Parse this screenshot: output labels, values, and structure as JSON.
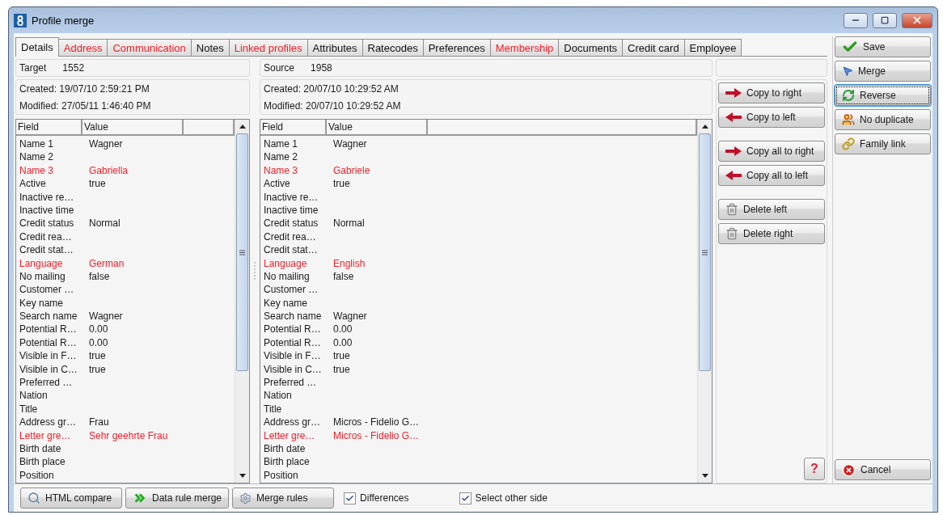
{
  "window": {
    "title": "Profile merge"
  },
  "tabs": [
    {
      "label": "Details",
      "selected": true,
      "differs": false
    },
    {
      "label": "Address",
      "selected": false,
      "differs": true
    },
    {
      "label": "Communication",
      "selected": false,
      "differs": true
    },
    {
      "label": "Notes",
      "selected": false,
      "differs": false
    },
    {
      "label": "Linked profiles",
      "selected": false,
      "differs": true
    },
    {
      "label": "Attributes",
      "selected": false,
      "differs": false
    },
    {
      "label": "Ratecodes",
      "selected": false,
      "differs": false
    },
    {
      "label": "Preferences",
      "selected": false,
      "differs": false
    },
    {
      "label": "Membership",
      "selected": false,
      "differs": true
    },
    {
      "label": "Documents",
      "selected": false,
      "differs": false
    },
    {
      "label": "Credit card",
      "selected": false,
      "differs": false
    },
    {
      "label": "Employee",
      "selected": false,
      "differs": false
    }
  ],
  "panels": [
    {
      "label": "Target",
      "id": "1552",
      "created": "Created: 19/07/10 2:59:21 PM",
      "modified": "Modified: 27/05/11 1:46:40 PM",
      "columns": [
        "Field",
        "Value"
      ],
      "rows": [
        {
          "field": "Name 1",
          "value": "Wagner",
          "differs": false
        },
        {
          "field": "Name 2",
          "differs": false
        },
        {
          "field": "Name 3",
          "value": "Gabriella",
          "differs": true
        },
        {
          "field": "Active",
          "value": "true",
          "differs": false
        },
        {
          "field": "Inactive re…",
          "differs": false
        },
        {
          "field": "Inactive time",
          "differs": false
        },
        {
          "field": "Credit status",
          "value": "Normal",
          "differs": false
        },
        {
          "field": "Credit rea…",
          "differs": false
        },
        {
          "field": "Credit stat…",
          "differs": false
        },
        {
          "field": "Language",
          "value": "German",
          "differs": true
        },
        {
          "field": "No mailing",
          "value": "false",
          "differs": false
        },
        {
          "field": "Customer …",
          "differs": false
        },
        {
          "field": "Key name",
          "differs": false
        },
        {
          "field": "Search name",
          "value": "Wagner",
          "differs": false
        },
        {
          "field": "Potential R…",
          "value": "0.00",
          "differs": false
        },
        {
          "field": "Potential R…",
          "value": "0.00",
          "differs": false
        },
        {
          "field": "Visible in F…",
          "value": "true",
          "differs": false
        },
        {
          "field": "Visible in C…",
          "value": "true",
          "differs": false
        },
        {
          "field": "Preferred …",
          "differs": false
        },
        {
          "field": "Nation",
          "differs": false
        },
        {
          "field": "Title",
          "differs": false
        },
        {
          "field": "Address gr…",
          "value": "Frau",
          "differs": false
        },
        {
          "field": "Letter gre…",
          "value": "Sehr geehrte Frau",
          "differs": true
        },
        {
          "field": "Birth date",
          "differs": false
        },
        {
          "field": "Birth place",
          "differs": false
        },
        {
          "field": "Position",
          "differs": false
        }
      ]
    },
    {
      "label": "Source",
      "id": "1958",
      "created": "Created: 20/07/10 10:29:52 AM",
      "modified": "Modified: 20/07/10 10:29:52 AM",
      "columns": [
        "Field",
        "Value"
      ],
      "rows": [
        {
          "field": "Name 1",
          "value": "Wagner",
          "differs": false
        },
        {
          "field": "Name 2",
          "differs": false
        },
        {
          "field": "Name 3",
          "value": "Gabriele",
          "differs": true
        },
        {
          "field": "Active",
          "value": "true",
          "differs": false
        },
        {
          "field": "Inactive re…",
          "differs": false
        },
        {
          "field": "Inactive time",
          "differs": false
        },
        {
          "field": "Credit status",
          "value": "Normal",
          "differs": false
        },
        {
          "field": "Credit rea…",
          "differs": false
        },
        {
          "field": "Credit stat…",
          "differs": false
        },
        {
          "field": "Language",
          "value": "English",
          "differs": true
        },
        {
          "field": "No mailing",
          "value": "false",
          "differs": false
        },
        {
          "field": "Customer …",
          "differs": false
        },
        {
          "field": "Key name",
          "differs": false
        },
        {
          "field": "Search name",
          "value": "Wagner",
          "differs": false
        },
        {
          "field": "Potential R…",
          "value": "0.00",
          "differs": false
        },
        {
          "field": "Potential R…",
          "value": "0.00",
          "differs": false
        },
        {
          "field": "Visible in F…",
          "value": "true",
          "differs": false
        },
        {
          "field": "Visible in C…",
          "value": "true",
          "differs": false
        },
        {
          "field": "Preferred …",
          "differs": false
        },
        {
          "field": "Nation",
          "differs": false
        },
        {
          "field": "Title",
          "differs": false
        },
        {
          "field": "Address gr…",
          "value": "Micros - Fidelio G…",
          "differs": false
        },
        {
          "field": "Letter gre…",
          "value": "Micros - Fidelio G…",
          "differs": true
        },
        {
          "field": "Birth date",
          "differs": false
        },
        {
          "field": "Birth place",
          "differs": false
        },
        {
          "field": "Position",
          "differs": false
        }
      ]
    }
  ],
  "copy_actions": [
    [
      {
        "label": "Copy to right",
        "kind": "right"
      },
      {
        "label": "Copy to left",
        "kind": "left"
      }
    ],
    [
      {
        "label": "Copy all to right",
        "kind": "right"
      },
      {
        "label": "Copy all to left",
        "kind": "left"
      }
    ],
    [
      {
        "label": "Delete left",
        "kind": "delete"
      },
      {
        "label": "Delete right",
        "kind": "delete"
      }
    ]
  ],
  "help_button": {
    "label": "?"
  },
  "side_buttons": [
    {
      "label": "Save",
      "kind": "save",
      "focused": false
    },
    {
      "label": "Merge",
      "kind": "merge",
      "focused": false
    },
    {
      "label": "Reverse",
      "kind": "reverse",
      "focused": true
    },
    {
      "label": "No duplicate",
      "kind": "duplicate",
      "focused": false
    },
    {
      "label": "Family link",
      "kind": "link",
      "focused": false
    }
  ],
  "cancel_button": {
    "label": "Cancel"
  },
  "bottom_buttons": [
    {
      "label": "HTML compare",
      "kind": "compare"
    },
    {
      "label": "Data rule merge",
      "kind": "rule"
    },
    {
      "label": "Merge rules",
      "kind": "gear"
    }
  ],
  "checkboxes": [
    {
      "label": "Differences",
      "checked": true
    },
    {
      "label": "Select other side",
      "checked": true
    }
  ]
}
